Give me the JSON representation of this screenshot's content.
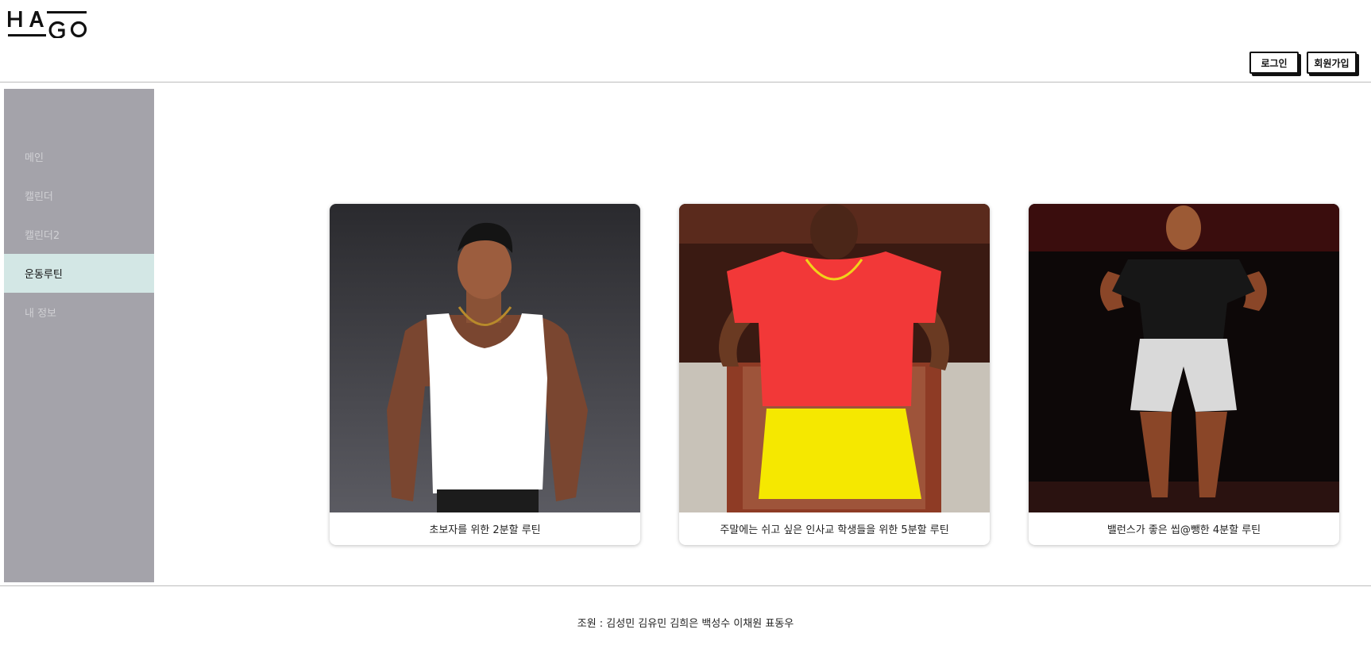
{
  "header": {
    "logo_text": "HAGO",
    "login_label": "로그인",
    "signup_label": "회원가입"
  },
  "sidebar": {
    "items": [
      {
        "label": "메인",
        "active": false
      },
      {
        "label": "캘린더",
        "active": false
      },
      {
        "label": "캘린더2",
        "active": false
      },
      {
        "label": "운동루틴",
        "active": true
      },
      {
        "label": "내 정보",
        "active": false
      }
    ]
  },
  "routines": [
    {
      "title": "초보자를 위한 2분할 루틴"
    },
    {
      "title": "주말에는 쉬고 싶은 인사교 학생들을 위한 5분할 루틴"
    },
    {
      "title": "밸런스가 좋은 씹@뺑한 4분할 루틴"
    }
  ],
  "footer": {
    "text": "조원 : 김성민 김유민 김희은 백성수 이채원 표동우"
  },
  "colors": {
    "sidebar_bg": "#a4a3aa",
    "sidebar_active_bg": "#d3e7e5",
    "border": "#bdbdbd"
  }
}
